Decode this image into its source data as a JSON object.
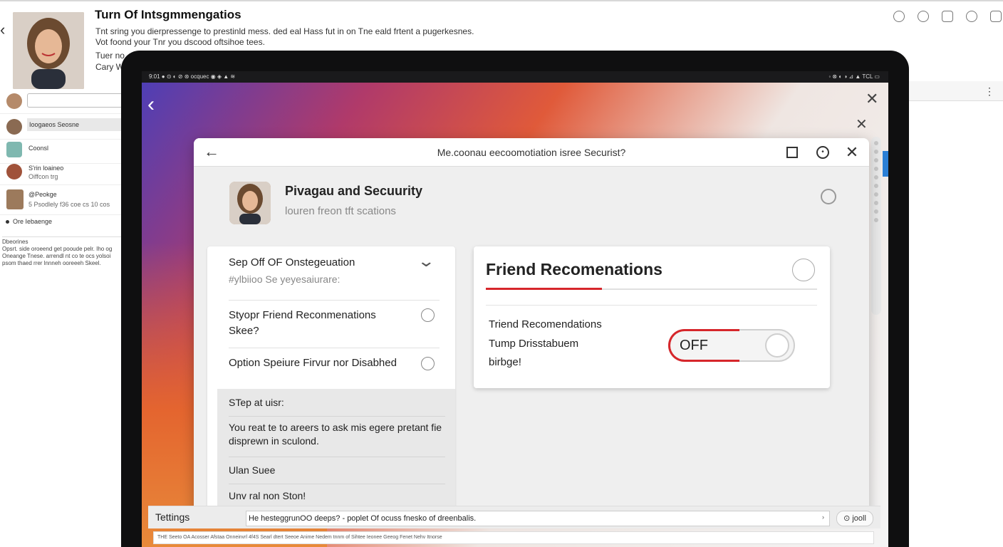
{
  "article": {
    "title": "Turn Of Intsgmmengatios",
    "line1": "Tnt sring you dierpressenge to prestinld mess. ded eal Hass fut in on Tne eald frtent a pugerkesnes.",
    "line2": "Vot foond your Tnr you dscood oftsihoe tees.",
    "line3": "Tuer no",
    "line4": "Cary W"
  },
  "sidebar": {
    "items": [
      {
        "label": ""
      },
      {
        "label": "Ioogaeos Seosne"
      },
      {
        "label": "Coonsl"
      },
      {
        "label": "S'rin loaineo",
        "sub": "Oiffcon trg"
      },
      {
        "label": "@Peokge",
        "sub": "5 Psodlely f36 coe cs 10 cos"
      }
    ],
    "bullet": "Ore Iebaenge",
    "para_title": "Dbeorines",
    "para": "Opsrt. side oroeend get pooude pelr. Iho og Oneange Tnese. arrendl nt co te ocs yolsoi psom thaed rrer lnnneh ooreeeh Skeel."
  },
  "statusbar": {
    "left": "9:01 ●  ⊙  ◐  ⊘  ⊛  ocquec  ◉  ◈  ▲  ≋",
    "right": "◦ ⊗ ◐ ◑ ⊿ ▲ TCL ▭"
  },
  "dialog": {
    "title": "Me.coonau eecoomotiation isree Securist?",
    "profile_title": "Pivagau and Secuurity",
    "profile_sub": "louren freon tft scations",
    "left": {
      "heading": "Sep Off OF Onstegeuation",
      "subheading": "#ylbiioo Se yeyesaiurare:",
      "option1": "Styopr Friend Reconmenations Skee?",
      "option2": "Option Speiure Firvur nor Disabhed",
      "step_label": "STep at uisr:",
      "step_text": "You reat te to areers to ask mis egere pretant fie disprewn in sculond.",
      "item1": "Ulan Suee",
      "item2": "Unv ral non Ston!"
    },
    "right": {
      "title": "Friend Recomenations",
      "progress": 0.35,
      "label1": "Triend Recomendations",
      "label2": "Tump Drisstabuem",
      "label3": "birbge!",
      "toggle_state": "OFF"
    }
  },
  "bottom": {
    "label": "Tettings",
    "input_text": "He hesteggrunOO deeps? - poplet Of ocuss fnesko of dreenbalis.",
    "button": "⊙ jooll",
    "footer": "THE Seeto OA Acosser Afstaa Onneinvrl 4f4S Searl dtert Seeoe Anime Nedem tnnm of Sihtee Ieonee Geeog Fenet Nehv Itnorse"
  }
}
